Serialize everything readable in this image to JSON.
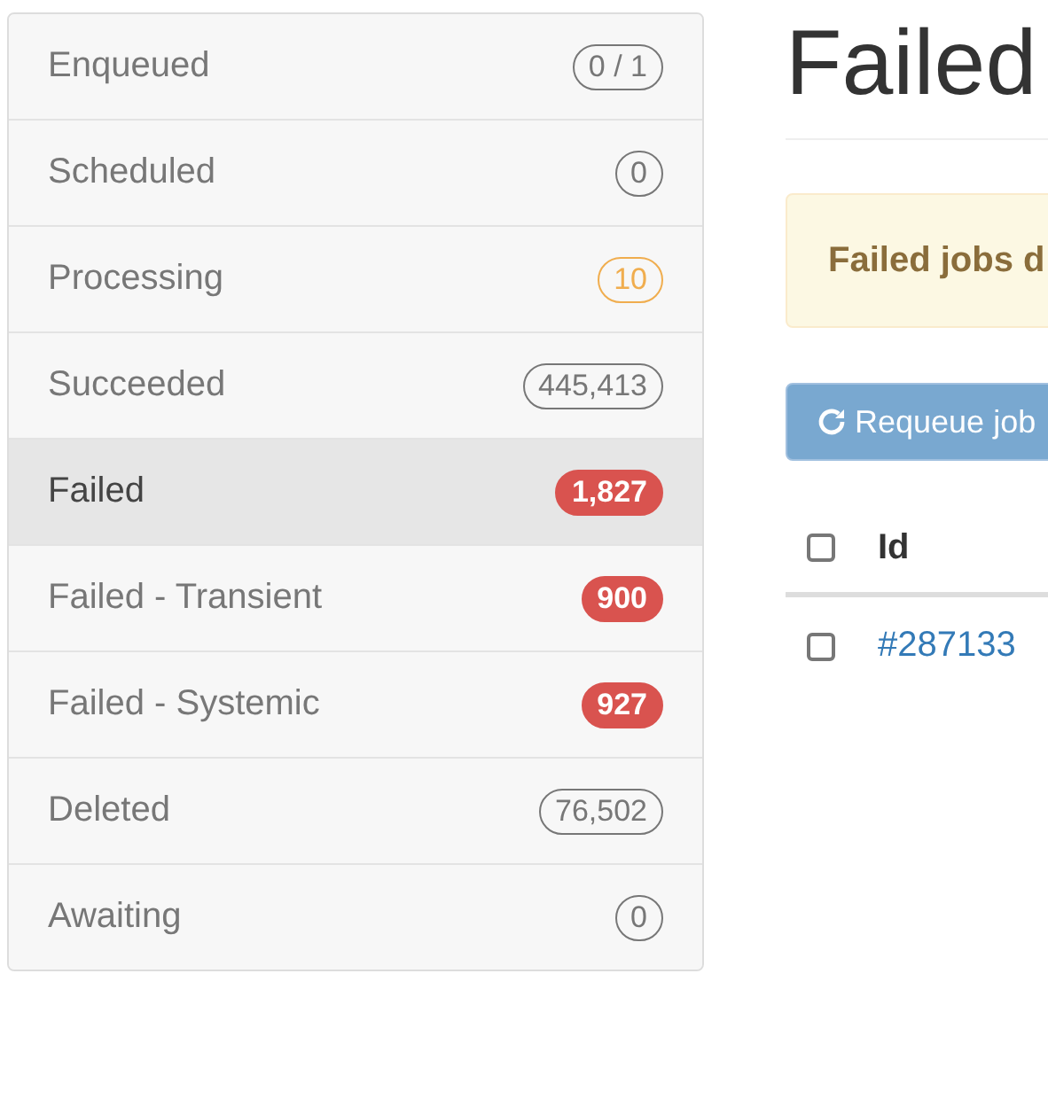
{
  "sidebar": {
    "items": [
      {
        "label": "Enqueued",
        "count": "0 / 1",
        "kind": "outline",
        "selected": false
      },
      {
        "label": "Scheduled",
        "count": "0",
        "kind": "outline",
        "selected": false
      },
      {
        "label": "Processing",
        "count": "10",
        "kind": "warning",
        "selected": false
      },
      {
        "label": "Succeeded",
        "count": "445,413",
        "kind": "outline",
        "selected": false
      },
      {
        "label": "Failed",
        "count": "1,827",
        "kind": "danger",
        "selected": true
      },
      {
        "label": "Failed - Transient",
        "count": "900",
        "kind": "danger",
        "selected": false
      },
      {
        "label": "Failed - Systemic",
        "count": "927",
        "kind": "danger",
        "selected": false
      },
      {
        "label": "Deleted",
        "count": "76,502",
        "kind": "outline",
        "selected": false
      },
      {
        "label": "Awaiting",
        "count": "0",
        "kind": "outline",
        "selected": false
      }
    ]
  },
  "page_title": "Failed",
  "alert": {
    "text": "Failed jobs d"
  },
  "requeue_button": {
    "label": "Requeue job",
    "disabled": true
  },
  "table": {
    "select_all": {
      "checked": false
    },
    "columns": [
      "Id"
    ],
    "rows": [
      {
        "id": "#287133",
        "checked": false
      }
    ]
  }
}
